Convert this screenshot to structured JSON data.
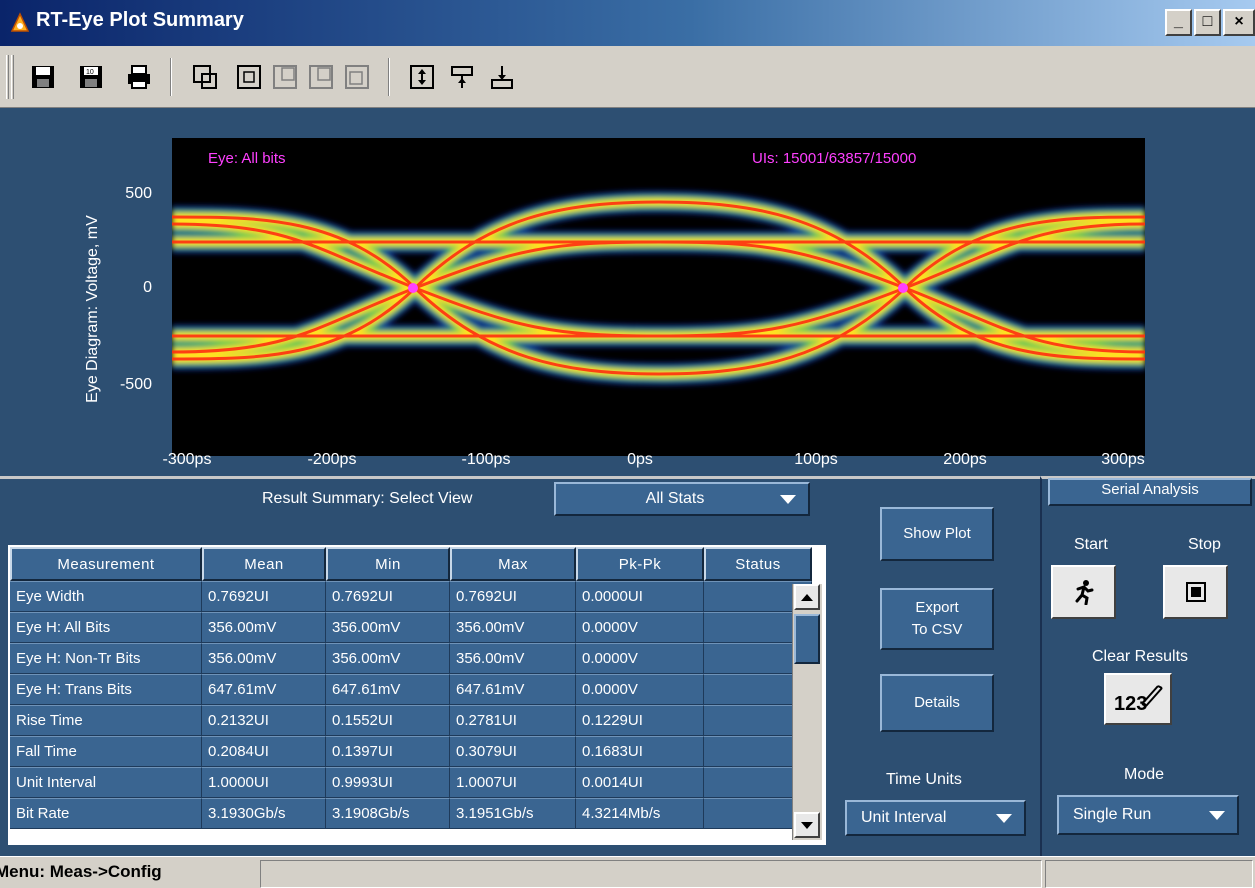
{
  "window": {
    "title": "RT-Eye Plot Summary"
  },
  "toolbar": {
    "buttons": [
      "save-icon",
      "save-as-icon",
      "print-icon",
      "zoom-window-icon",
      "zoom-in-icon",
      "zoom-out-icon",
      "zoom-reset-icon",
      "zoom-fit-icon",
      "vertical-fit-icon",
      "cursor-icon",
      "marker-icon"
    ]
  },
  "plot": {
    "eye_label": "Eye: All bits",
    "ui_label": "UIs: 15001/63857/15000",
    "ylabel": "Eye Diagram: Voltage, mV",
    "yticks": [
      "500",
      "0",
      "-500"
    ],
    "xticks": [
      "-300ps",
      "-200ps",
      "-100ps",
      "0ps",
      "100ps",
      "200ps",
      "300ps"
    ]
  },
  "result_summary": {
    "label": "Result Summary: Select View",
    "view": "All Stats"
  },
  "table": {
    "columns": [
      "Measurement",
      "Mean",
      "Min",
      "Max",
      "Pk-Pk",
      "Status"
    ],
    "rows": [
      [
        "Eye Width",
        "0.7692UI",
        "0.7692UI",
        "0.7692UI",
        "0.0000UI",
        ""
      ],
      [
        "Eye H: All Bits",
        "356.00mV",
        "356.00mV",
        "356.00mV",
        "0.0000V",
        ""
      ],
      [
        "Eye H: Non-Tr Bits",
        "356.00mV",
        "356.00mV",
        "356.00mV",
        "0.0000V",
        ""
      ],
      [
        "Eye H: Trans Bits",
        "647.61mV",
        "647.61mV",
        "647.61mV",
        "0.0000V",
        ""
      ],
      [
        "Rise Time",
        "0.2132UI",
        "0.1552UI",
        "0.2781UI",
        "0.1229UI",
        ""
      ],
      [
        "Fall Time",
        "0.2084UI",
        "0.1397UI",
        "0.3079UI",
        "0.1683UI",
        ""
      ],
      [
        "Unit Interval",
        "1.0000UI",
        "0.9993UI",
        "1.0007UI",
        "0.0014UI",
        ""
      ],
      [
        "Bit Rate",
        "3.1930Gb/s",
        "3.1908Gb/s",
        "3.1951Gb/s",
        "4.3214Mb/s",
        ""
      ]
    ]
  },
  "actions": {
    "show_plot": "Show Plot",
    "export_line1": "Export",
    "export_line2": "To CSV",
    "details": "Details",
    "time_units_label": "Time Units",
    "time_units_value": "Unit Interval"
  },
  "serial": {
    "header": "Serial Analysis",
    "start": "Start",
    "stop": "Stop",
    "clear_results": "Clear Results",
    "mode_label": "Mode",
    "mode_value": "Single Run"
  },
  "status": {
    "text": "Menu: Meas->Config"
  },
  "colors": {
    "panel": "#2d4f72",
    "button": "#3a6591",
    "eye_label": "#ff40ff"
  }
}
